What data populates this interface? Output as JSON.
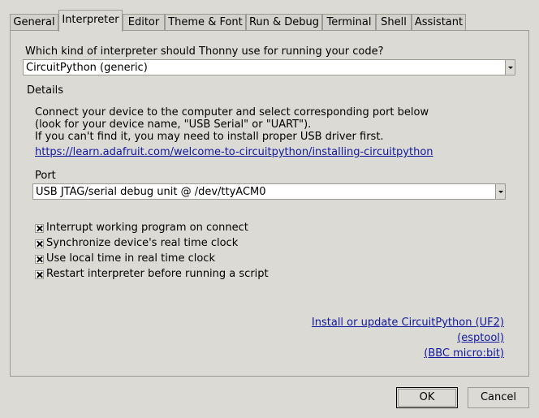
{
  "tabs": [
    {
      "label": "General"
    },
    {
      "label": "Interpreter",
      "active": true
    },
    {
      "label": "Editor"
    },
    {
      "label": "Theme & Font"
    },
    {
      "label": "Run & Debug"
    },
    {
      "label": "Terminal"
    },
    {
      "label": "Shell"
    },
    {
      "label": "Assistant"
    }
  ],
  "interpreter": {
    "question": "Which kind of interpreter should Thonny use for running your code?",
    "selected": "CircuitPython (generic)"
  },
  "details": {
    "heading": "Details",
    "line1": "Connect your device to the computer and select corresponding port below",
    "line2": "(look for your device name, \"USB Serial\" or \"UART\").",
    "line3": "If you can't find it, you may need to install proper USB driver first.",
    "link": "https://learn.adafruit.com/welcome-to-circuitpython/installing-circuitpython"
  },
  "port": {
    "label": "Port",
    "selected": "USB JTAG/serial debug unit @ /dev/ttyACM0"
  },
  "options": [
    {
      "label": "Interrupt working program on connect",
      "checked": true
    },
    {
      "label": "Synchronize device's real time clock",
      "checked": true
    },
    {
      "label": "Use local time in real time clock",
      "checked": true
    },
    {
      "label": "Restart interpreter before running a script",
      "checked": true
    }
  ],
  "links": {
    "install": "Install or update CircuitPython (UF2)",
    "esptool": "(esptool)",
    "microbit": "(BBC micro:bit)"
  },
  "buttons": {
    "ok": "OK",
    "cancel": "Cancel"
  },
  "colors": {
    "background": "#dcdad5",
    "link": "#1018a0",
    "border": "#9d9a92"
  }
}
